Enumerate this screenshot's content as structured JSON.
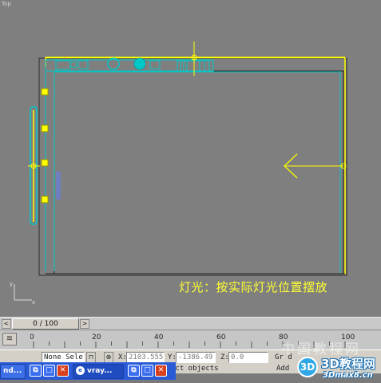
{
  "viewport": {
    "label": "Top",
    "annotation": "灯光：按实际灯光位置摆放",
    "axis": {
      "x_label": "x",
      "y_label": "y"
    }
  },
  "timeslider": {
    "frame_display": "0 / 100",
    "prev_symbol": "<",
    "next_symbol": ">"
  },
  "trackbar": {
    "ticks": [
      "0",
      "20",
      "40",
      "60",
      "80",
      "100"
    ]
  },
  "statusbar": {
    "selection": "None Sele",
    "lock_symbol": "🔒",
    "x_label": "X:",
    "x_value": "2103.555",
    "y_label": "Y:",
    "y_value": "-1386.49",
    "z_label": "Z:",
    "z_value": "0.0",
    "grid_label": "Gr d",
    "add_label": "Add"
  },
  "promptline": {
    "text": "ect objects"
  },
  "taskbar": {
    "items": [
      {
        "label": "nd..."
      },
      {
        "label": "vray..."
      }
    ]
  },
  "watermark": {
    "text1": "中国教程网",
    "logo_text": "3D教程网",
    "logo_sub": "3Dmax8.cn",
    "logo_badge": "3D"
  },
  "colors": {
    "viewport_bg": "#7f7f7f",
    "wall": "#ffff00",
    "object": "#00c8c8",
    "selection": "#1a1a1a",
    "annotation": "#ffff33"
  }
}
